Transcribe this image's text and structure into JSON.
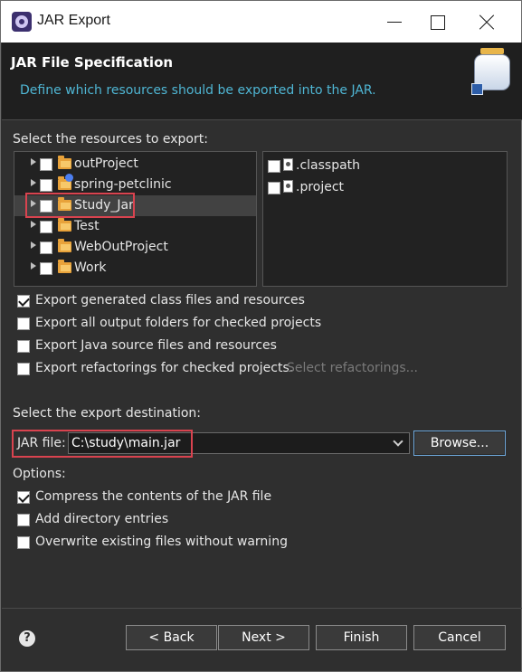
{
  "window": {
    "title": "JAR Export"
  },
  "header": {
    "title": "JAR File Specification",
    "description": "Define which resources should be exported into the JAR."
  },
  "resources": {
    "label": "Select the resources to export:",
    "projects": [
      {
        "name": "outProject",
        "checked": false
      },
      {
        "name": "spring-petclinic",
        "checked": false
      },
      {
        "name": "Study_Jar",
        "checked": false,
        "selected": true
      },
      {
        "name": "Test",
        "checked": false
      },
      {
        "name": "WebOutProject",
        "checked": false
      },
      {
        "name": "Work",
        "checked": false
      }
    ],
    "files": [
      {
        "name": ".classpath",
        "checked": false
      },
      {
        "name": ".project",
        "checked": false
      }
    ]
  },
  "export_options": [
    {
      "label": "Export generated class files and resources",
      "checked": true
    },
    {
      "label": "Export all output folders for checked projects",
      "checked": false
    },
    {
      "label": "Export Java source files and resources",
      "checked": false
    },
    {
      "label": "Export refactorings for checked projects.",
      "checked": false
    }
  ],
  "select_refactorings_link": "Select refactorings...",
  "destination": {
    "label": "Select the export destination:",
    "jar_file_label": "JAR file:",
    "jar_file_value": "C:\\study\\main.jar",
    "browse_label": "Browse..."
  },
  "options": {
    "label": "Options:",
    "items": [
      {
        "label": "Compress the contents of the JAR file",
        "checked": true
      },
      {
        "label": "Add directory entries",
        "checked": false
      },
      {
        "label": "Overwrite existing files without warning",
        "checked": false
      }
    ]
  },
  "buttons": {
    "help": "?",
    "back": "< Back",
    "next": "Next >",
    "finish": "Finish",
    "cancel": "Cancel"
  },
  "colors": {
    "highlight_box": "#d9434f",
    "description": "#4fb6d4",
    "background": "#2f2f2f"
  }
}
